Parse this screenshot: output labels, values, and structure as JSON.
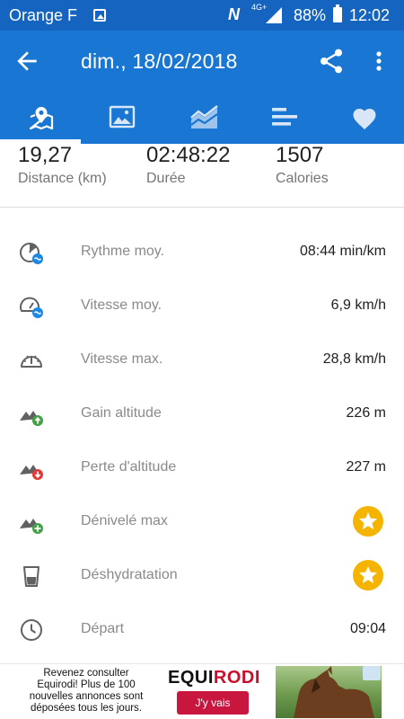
{
  "status_bar": {
    "carrier": "Orange F",
    "nfc": "N",
    "network": "4G+",
    "battery": "88%",
    "time": "12:02"
  },
  "app_bar": {
    "title": "dim., 18/02/2018"
  },
  "tabs": [
    {
      "icon": "map-icon",
      "selected": true
    },
    {
      "icon": "image-icon",
      "selected": false
    },
    {
      "icon": "chart-icon",
      "selected": false
    },
    {
      "icon": "bars-icon",
      "selected": false
    },
    {
      "icon": "heart-icon",
      "selected": false
    }
  ],
  "summary": {
    "distance": {
      "value": "19,27",
      "label": "Distance (km)"
    },
    "duration": {
      "value": "02:48:22",
      "label": "Durée"
    },
    "calories": {
      "value": "1507",
      "label": "Calories"
    }
  },
  "stats": [
    {
      "label": "Rythme moy.",
      "value": "08:44 min/km",
      "icon": "pace-icon"
    },
    {
      "label": "Vitesse moy.",
      "value": "6,9 km/h",
      "icon": "avg-speed-icon"
    },
    {
      "label": "Vitesse max.",
      "value": "28,8 km/h",
      "icon": "max-speed-icon"
    },
    {
      "label": "Gain altitude",
      "value": "226 m",
      "icon": "elevation-gain-icon"
    },
    {
      "label": "Perte d'altitude",
      "value": "227 m",
      "icon": "elevation-loss-icon"
    },
    {
      "label": "Dénivelé max",
      "value": "",
      "icon": "elevation-max-icon",
      "premium_icon": "star-icon"
    },
    {
      "label": "Déshydratation",
      "value": "",
      "icon": "glass-icon",
      "premium_icon": "star-icon"
    },
    {
      "label": "Départ",
      "value": "09:04",
      "icon": "clock-icon"
    }
  ],
  "ad": {
    "text": "Revenez consulter Equirodi! Plus de 100 nouvelles annonces sont déposées tous les jours.",
    "logo_part1": "EQUI",
    "logo_part2": "RODI",
    "cta": "J'y vais"
  },
  "colors": {
    "status_bar": "#1565c0",
    "app_bar": "#1976d2",
    "star_badge": "#f5b400",
    "gain_green": "#43a047",
    "loss_red": "#e53935",
    "speed_blue": "#1e88e5"
  }
}
